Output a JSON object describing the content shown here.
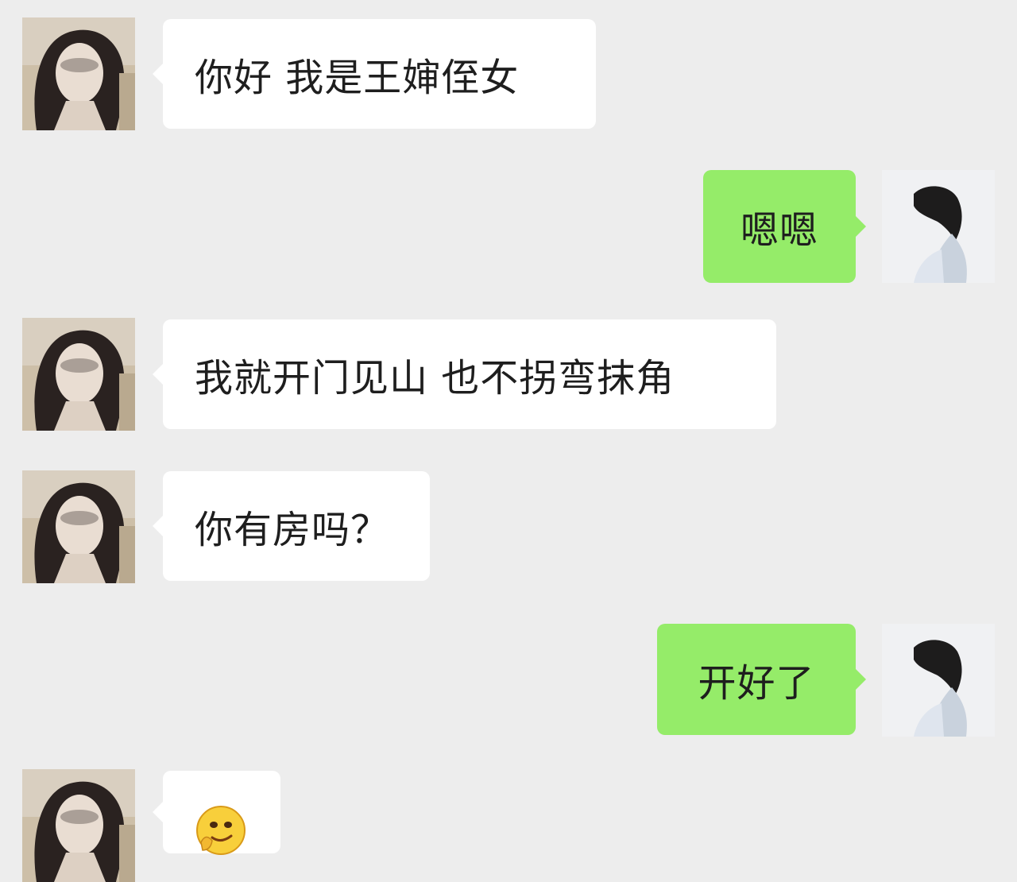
{
  "messages": [
    {
      "side": "in",
      "text": "你好 我是王婶侄女"
    },
    {
      "side": "out",
      "text": "嗯嗯"
    },
    {
      "side": "in",
      "text": "我就开门见山 也不拐弯抹角"
    },
    {
      "side": "in",
      "text": "你有房吗？"
    },
    {
      "side": "out",
      "text": "开好了"
    },
    {
      "side": "in",
      "text": "",
      "sticker": "smirk-emoji"
    }
  ],
  "colors": {
    "background": "#ededed",
    "incoming_bubble": "#ffffff",
    "outgoing_bubble": "#95ec69"
  }
}
